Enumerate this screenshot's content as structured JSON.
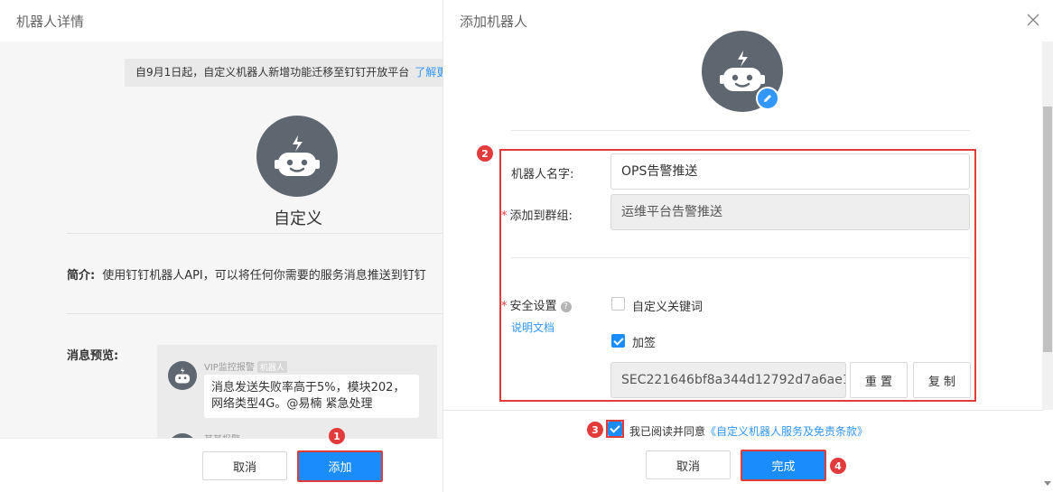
{
  "left_panel": {
    "title": "机器人详情",
    "notice": "自9月1日起，自定义机器人新增功能迁移至钉钉开放平台",
    "notice_link": "了解更多",
    "robot_name": "自定义",
    "desc_label": "简介:",
    "desc_text": "使用钉钉机器人API，可以将任何你需要的服务消息推送到钉钉",
    "preview_label": "消息预览:",
    "preview": {
      "sender": "VIP监控报警",
      "badge": "机器人",
      "message": "消息发送失败率高于5%，模块202，网络类型4G。@易楠 紧急处理",
      "sender2": "某某报警"
    },
    "cancel_label": "取消",
    "add_label": "添加",
    "step_add": "1"
  },
  "right_panel": {
    "title": "添加机器人",
    "step_form": "2",
    "name_label": "机器人名字:",
    "name_value": "OPS告警推送",
    "group_label": "添加到群组:",
    "group_value": "运维平台告警推送",
    "security_label": "安全设置",
    "doc_link": "说明文档",
    "keyword_label": "自定义关键词",
    "keyword_checked": false,
    "sign_label": "加签",
    "sign_checked": true,
    "secret_value": "SEC221646bf8a344d12792d7a6ae1",
    "reset_label": "重 置",
    "copy_label": "复 制",
    "step_agree": "3",
    "agree_text": "我已阅读并同意",
    "agree_link": "《自定义机器人服务及免责条款》",
    "agree_checked": true,
    "cancel_label": "取消",
    "done_label": "完成",
    "step_done": "4"
  },
  "colors": {
    "accent": "#1a8cfb",
    "highlight": "#e23b3b",
    "link": "#3296fa",
    "avatar_bg": "#5e6770"
  },
  "icons": [
    "robot-icon",
    "pencil-icon",
    "close-icon",
    "help-icon",
    "check-icon"
  ]
}
